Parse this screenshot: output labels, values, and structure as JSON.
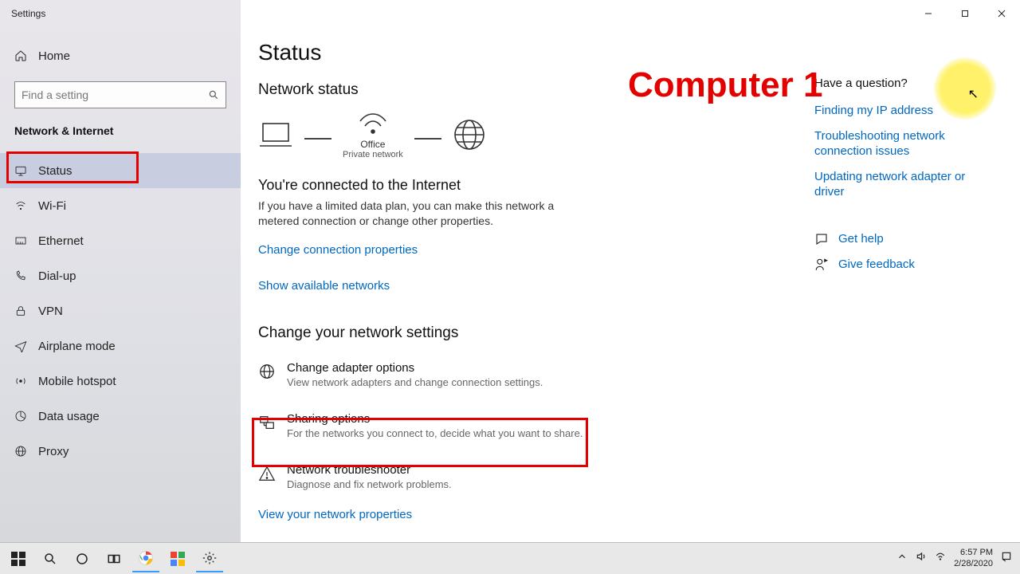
{
  "window_title": "Settings",
  "annotation": "Computer 1",
  "sidebar": {
    "home": "Home",
    "search_placeholder": "Find a setting",
    "category": "Network & Internet",
    "items": [
      {
        "label": "Status"
      },
      {
        "label": "Wi-Fi"
      },
      {
        "label": "Ethernet"
      },
      {
        "label": "Dial-up"
      },
      {
        "label": "VPN"
      },
      {
        "label": "Airplane mode"
      },
      {
        "label": "Mobile hotspot"
      },
      {
        "label": "Data usage"
      },
      {
        "label": "Proxy"
      }
    ]
  },
  "page": {
    "title": "Status",
    "section1_heading": "Network status",
    "diagram": {
      "wifi_name": "Office",
      "wifi_sub": "Private network"
    },
    "connected_heading": "You're connected to the Internet",
    "connected_body": "If you have a limited data plan, you can make this network a metered connection or change other properties.",
    "link_change_props": "Change connection properties",
    "link_show_networks": "Show available networks",
    "section2_heading": "Change your network settings",
    "options": [
      {
        "title": "Change adapter options",
        "desc": "View network adapters and change connection settings."
      },
      {
        "title": "Sharing options",
        "desc": "For the networks you connect to, decide what you want to share."
      },
      {
        "title": "Network troubleshooter",
        "desc": "Diagnose and fix network problems."
      }
    ],
    "link_view_props": "View your network properties"
  },
  "right_pane": {
    "heading": "Have a question?",
    "links": [
      "Finding my IP address",
      "Troubleshooting network connection issues",
      "Updating network adapter or driver"
    ],
    "get_help": "Get help",
    "give_feedback": "Give feedback"
  },
  "taskbar": {
    "time": "6:57 PM",
    "date": "2/28/2020"
  }
}
